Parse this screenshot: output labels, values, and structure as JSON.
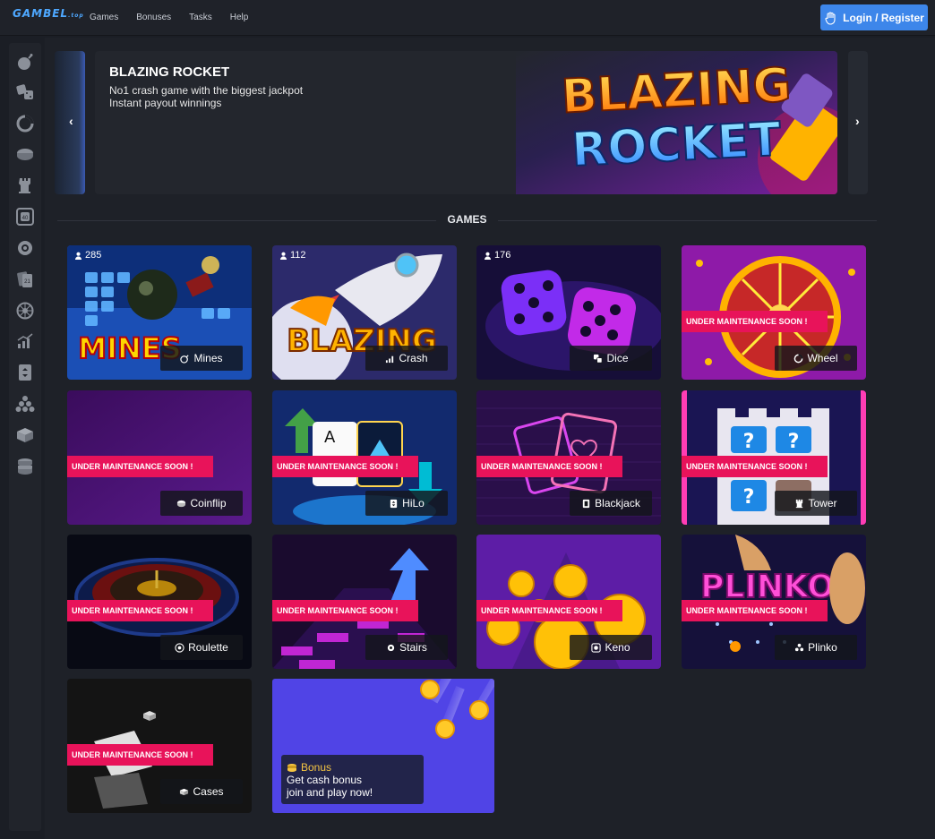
{
  "header": {
    "logo": "GAMBEL",
    "logo_sub": ".top",
    "nav": [
      "Games",
      "Bonuses",
      "Tasks",
      "Help"
    ],
    "login_label": "Login / Register"
  },
  "sidebar": {
    "icons": [
      "mines-icon",
      "dice-icon",
      "wheel-icon",
      "coinflip-icon",
      "tower-icon",
      "keno-icon",
      "stairs-icon",
      "blackjack-icon",
      "roulette-icon",
      "crash-icon",
      "hilo-icon",
      "plinko-icon",
      "cases-icon",
      "coins-icon"
    ]
  },
  "banner": {
    "title": "BLAZING ROCKET",
    "subtitle_1": "No1 crash game with the biggest jackpot",
    "subtitle_2": "Instant payout winnings",
    "art_text_1": "BLAZING",
    "art_text_2": "ROCKET",
    "prev_arrow": "‹",
    "next_arrow": "›"
  },
  "games_section": {
    "title": "GAMES",
    "maintenance_text": "UNDER MAINTENANCE SOON !",
    "cards": [
      {
        "name": "Mines",
        "players": "285",
        "icon": "mines-icon"
      },
      {
        "name": "Crash",
        "players": "112",
        "icon": "crash-icon"
      },
      {
        "name": "Dice",
        "players": "176",
        "icon": "dice-icon"
      },
      {
        "name": "Wheel",
        "icon": "wheel-icon"
      },
      {
        "name": "Coinflip",
        "icon": "coinflip-icon"
      },
      {
        "name": "HiLo",
        "icon": "hilo-icon"
      },
      {
        "name": "Blackjack",
        "icon": "blackjack-icon"
      },
      {
        "name": "Tower",
        "icon": "tower-icon"
      },
      {
        "name": "Roulette",
        "icon": "roulette-icon"
      },
      {
        "name": "Stairs",
        "icon": "stairs-icon"
      },
      {
        "name": "Keno",
        "icon": "keno-icon"
      },
      {
        "name": "Plinko",
        "icon": "plinko-icon"
      },
      {
        "name": "Cases",
        "icon": "cases-icon"
      }
    ],
    "art_text": {
      "mines": "MINES",
      "crash": "BLAZING",
      "plinko": "PLINKO"
    }
  },
  "bonus": {
    "title": "Bonus",
    "line1": "Get cash bonus",
    "line2": "join and play now!"
  },
  "colors": {
    "accent": "#3d86ea",
    "maintenance": "#e8135a",
    "bonus_bg": "#5044e6",
    "page_bg": "#1b1e25"
  }
}
